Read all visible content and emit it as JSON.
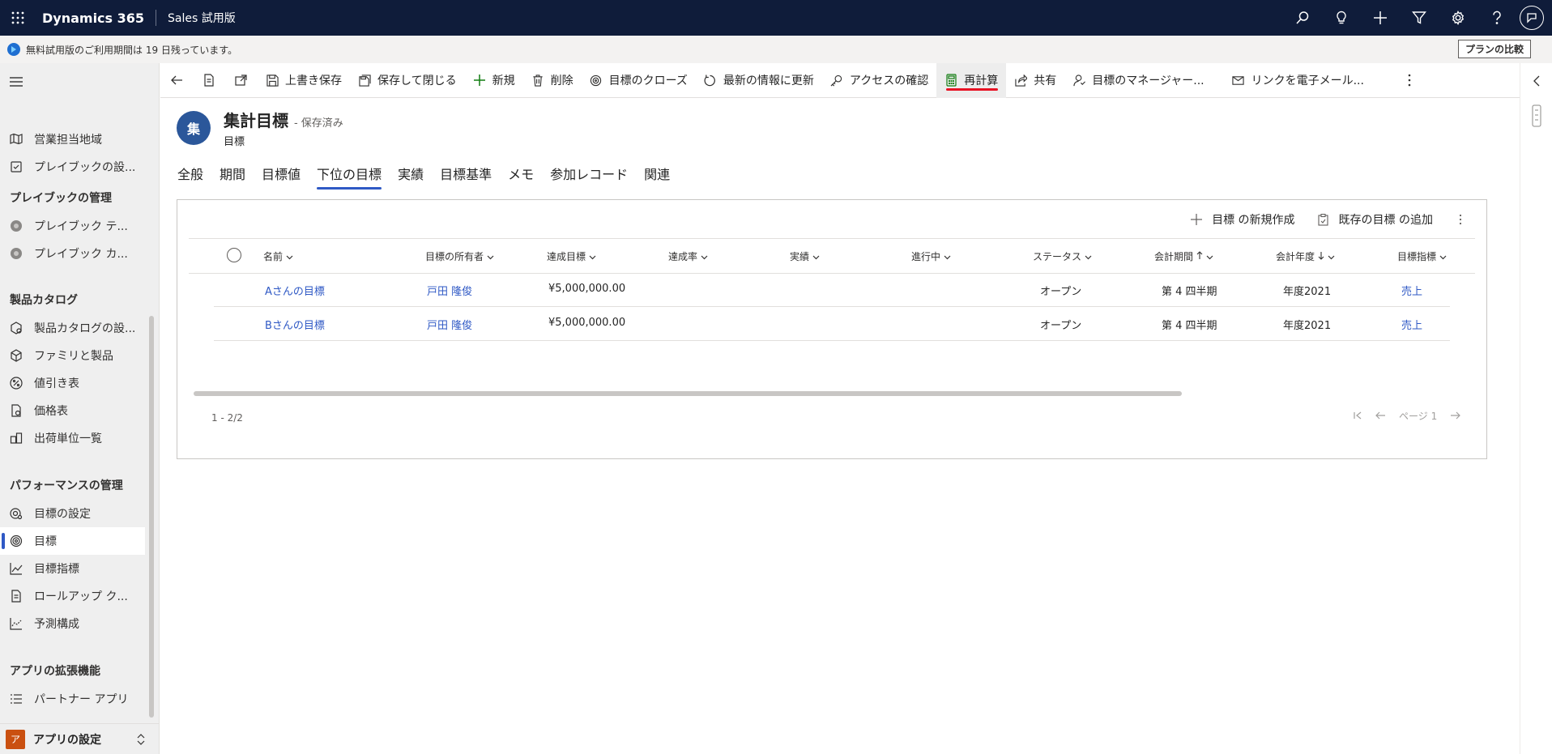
{
  "topbar": {
    "app_name": "Dynamics 365",
    "area_name": "Sales 試用版",
    "icons": [
      "search-icon",
      "lightbulb-icon",
      "plus-icon",
      "filter-icon",
      "settings-icon",
      "help-icon",
      "user-avatar-icon"
    ]
  },
  "notice": {
    "text": "無料試用版のご利用期間は 19 日残っています。",
    "plan_button": "プランの比較"
  },
  "sidebar": {
    "items_top": [
      {
        "label": "営業担当地域",
        "icon": "map-icon"
      },
      {
        "label": "プレイブックの設...",
        "icon": "checklist-icon"
      }
    ],
    "group_playbook": "プレイブックの管理",
    "items_playbook": [
      {
        "label": "プレイブック テ...",
        "icon": "playbook-icon"
      },
      {
        "label": "プレイブック カ...",
        "icon": "playbook-icon"
      }
    ],
    "group_catalog": "製品カタログ",
    "items_catalog": [
      {
        "label": "製品カタログの設...",
        "icon": "catalog-icon"
      },
      {
        "label": "ファミリと製品",
        "icon": "box-icon"
      },
      {
        "label": "値引き表",
        "icon": "discount-icon"
      },
      {
        "label": "価格表",
        "icon": "pricelist-icon"
      },
      {
        "label": "出荷単位一覧",
        "icon": "unit-icon"
      }
    ],
    "group_performance": "パフォーマンスの管理",
    "items_performance": [
      {
        "label": "目標の設定",
        "icon": "goal-settings-icon"
      },
      {
        "label": "目標",
        "icon": "target-icon"
      },
      {
        "label": "目標指標",
        "icon": "metric-icon"
      },
      {
        "label": "ロールアップ ク...",
        "icon": "rollup-icon"
      },
      {
        "label": "予測構成",
        "icon": "forecast-icon"
      }
    ],
    "group_extensions": "アプリの拡張機能",
    "items_extensions": [
      {
        "label": "パートナー アプリ",
        "icon": "list-icon"
      }
    ],
    "bottom_badge": "ア",
    "bottom_label": "アプリの設定"
  },
  "commandbar": {
    "save": "上書き保存",
    "save_close": "保存して閉じる",
    "new": "新規",
    "delete": "削除",
    "close_goal": "目標のクローズ",
    "refresh": "最新の情報に更新",
    "check_access": "アクセスの確認",
    "recalculate": "再計算",
    "share": "共有",
    "goal_manager": "目標のマネージャー...",
    "email_link": "リンクを電子メール..."
  },
  "record": {
    "avatar": "集",
    "title": "集計目標",
    "saved": "- 保存済み",
    "entity": "目標"
  },
  "tabs": [
    "全般",
    "期間",
    "目標値",
    "下位の目標",
    "実績",
    "目標基準",
    "メモ",
    "参加レコード",
    "関連"
  ],
  "grid": {
    "new_goal": "目標 の新規作成",
    "add_existing": "既存の目標 の追加",
    "columns": [
      "名前",
      "目標の所有者",
      "達成目標",
      "達成率",
      "実績",
      "進行中",
      "ステータス",
      "会計期間",
      "会計年度",
      "目標指標"
    ],
    "rows": [
      {
        "name": "Aさんの目標",
        "owner": "戸田 隆俊",
        "target": "¥5,000,000.00",
        "percent": "",
        "actual": "",
        "inprogress": "",
        "status": "オープン",
        "period": "第 4 四半期",
        "year": "年度2021",
        "metric": "売上"
      },
      {
        "name": "Bさんの目標",
        "owner": "戸田 隆俊",
        "target": "¥5,000,000.00",
        "percent": "",
        "actual": "",
        "inprogress": "",
        "status": "オープン",
        "period": "第 4 四半期",
        "year": "年度2021",
        "metric": "売上"
      }
    ],
    "count": "1 - 2/2",
    "page": "ページ 1"
  }
}
